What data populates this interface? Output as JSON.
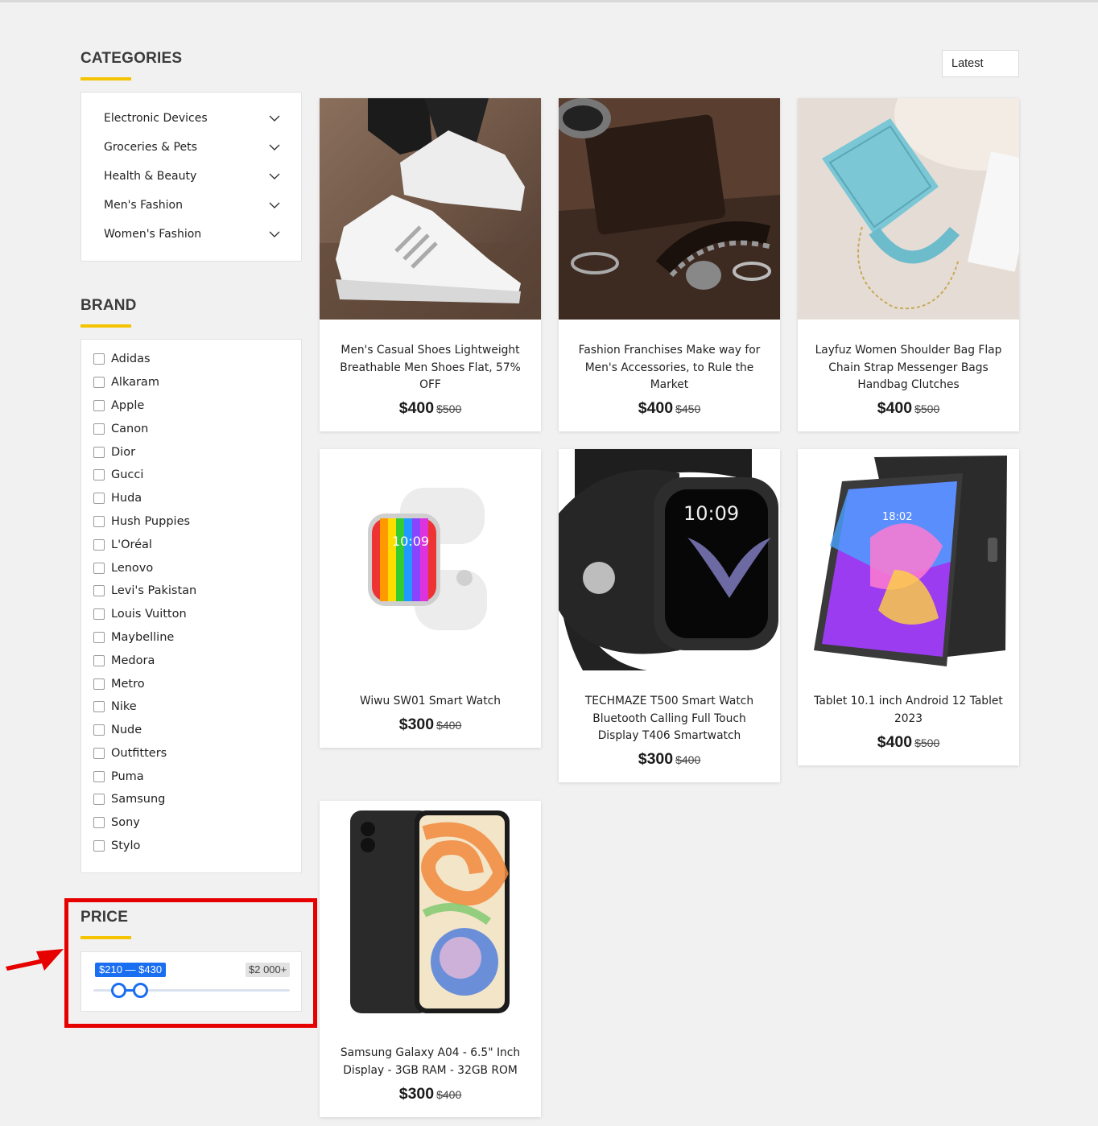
{
  "categories": {
    "title": "CATEGORIES",
    "items": [
      {
        "label": "Electronic Devices"
      },
      {
        "label": "Groceries & Pets"
      },
      {
        "label": "Health & Beauty"
      },
      {
        "label": "Men's Fashion"
      },
      {
        "label": "Women's Fashion"
      }
    ]
  },
  "brand": {
    "title": "BRAND",
    "items": [
      {
        "label": "Adidas"
      },
      {
        "label": "Alkaram"
      },
      {
        "label": "Apple"
      },
      {
        "label": "Canon"
      },
      {
        "label": "Dior"
      },
      {
        "label": "Gucci"
      },
      {
        "label": "Huda"
      },
      {
        "label": "Hush Puppies"
      },
      {
        "label": "L'Oréal"
      },
      {
        "label": "Lenovo"
      },
      {
        "label": "Levi's Pakistan"
      },
      {
        "label": "Louis Vuitton"
      },
      {
        "label": "Maybelline"
      },
      {
        "label": "Medora"
      },
      {
        "label": "Metro"
      },
      {
        "label": "Nike"
      },
      {
        "label": "Nude"
      },
      {
        "label": "Outfitters"
      },
      {
        "label": "Puma"
      },
      {
        "label": "Samsung"
      },
      {
        "label": "Sony"
      },
      {
        "label": "Stylo"
      }
    ]
  },
  "price": {
    "title": "PRICE",
    "range_label": "$210 — $430",
    "max_label": "$2 000+",
    "min_value": 210,
    "max_value": 430,
    "slider_max": 2000
  },
  "sort": {
    "selected": "Latest"
  },
  "products": [
    {
      "name_lines": [
        "Men's Casual Shoes Lightweight",
        "Breathable Men Shoes Flat, 57%",
        "OFF"
      ],
      "price": "$400",
      "old_price": "$500",
      "image": "white-sneaker"
    },
    {
      "name_lines": [
        "Fashion Franchises Make way for",
        "Men's Accessories, to Rule the",
        "Market"
      ],
      "price": "$400",
      "old_price": "$450",
      "image": "leather-accessories"
    },
    {
      "name_lines": [
        "Layfuz Women Shoulder Bag Flap",
        "Chain Strap Messenger Bags",
        "Handbag Clutches"
      ],
      "price": "$400",
      "old_price": "$500",
      "image": "blue-handbag"
    },
    {
      "name_lines": [
        "Wiwu SW01 Smart Watch"
      ],
      "price": "$300",
      "old_price": "$400",
      "image": "white-smartwatch"
    },
    {
      "name_lines": [
        "TECHMAZE T500 Smart Watch",
        "Bluetooth Calling Full Touch",
        "Display T406 Smartwatch"
      ],
      "price": "$300",
      "old_price": "$400",
      "image": "black-smartwatch"
    },
    {
      "name_lines": [
        "Tablet 10.1 inch Android 12 Tablet",
        "2023"
      ],
      "price": "$400",
      "old_price": "$500",
      "image": "android-tablet"
    },
    {
      "name_lines": [
        "Samsung Galaxy A04 - 6.5\" Inch",
        "Display - 3GB RAM - 32GB ROM"
      ],
      "price": "$300",
      "old_price": "$400",
      "image": "samsung-phone"
    }
  ],
  "colors": {
    "accent": "#f5c400",
    "slider": "#1a6ef0",
    "highlight": "#e60000"
  }
}
